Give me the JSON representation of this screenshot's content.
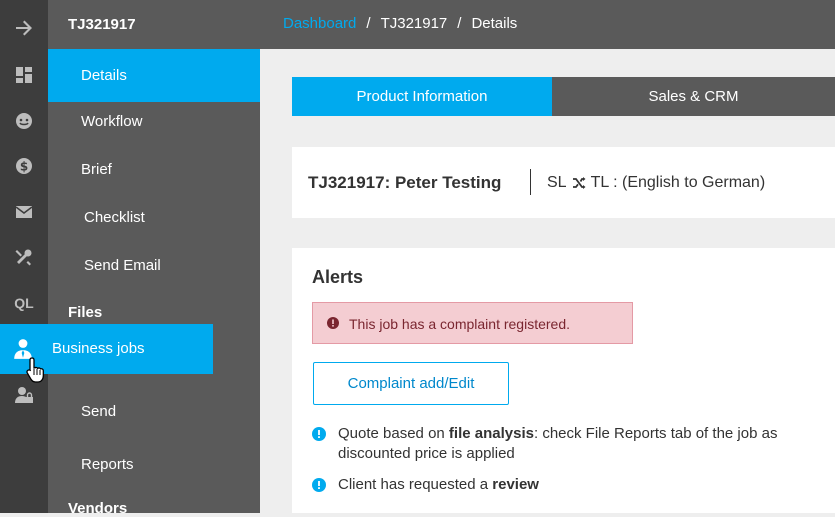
{
  "rail": {
    "ql_label": "QL"
  },
  "nav": {
    "title": "TJ321917",
    "items": [
      {
        "label": "Details"
      },
      {
        "label": "Workflow"
      },
      {
        "label": "Brief"
      },
      {
        "label": "Checklist"
      },
      {
        "label": "Send Email"
      }
    ],
    "files_section": "Files",
    "business_jobs": "Business jobs",
    "more_items": [
      {
        "label": "Send"
      },
      {
        "label": "Reports"
      }
    ],
    "vendors_section": "Vendors"
  },
  "breadcrumb": {
    "link": "Dashboard",
    "sep": "/",
    "job": "TJ321917",
    "page": "Details"
  },
  "tabs": [
    {
      "label": "Product Information"
    },
    {
      "label": "Sales & CRM"
    }
  ],
  "job": {
    "title": "TJ321917: Peter Testing",
    "sl": "SL",
    "tl": "TL : (English to German)"
  },
  "alerts": {
    "title": "Alerts",
    "complaint": "This job has a complaint registered.",
    "button": "Complaint add/Edit",
    "notes": [
      {
        "pre": "Quote based on ",
        "bold": "file analysis",
        "post": ": check File Reports tab of the job as discounted price is applied"
      },
      {
        "pre": "Client has requested a ",
        "bold": "review",
        "post": ""
      }
    ]
  },
  "colors": {
    "accent": "#00aaee",
    "sidebar": "#5a5a5a",
    "rail": "#3d3d3d",
    "alert_bg": "#f4cdd2"
  }
}
